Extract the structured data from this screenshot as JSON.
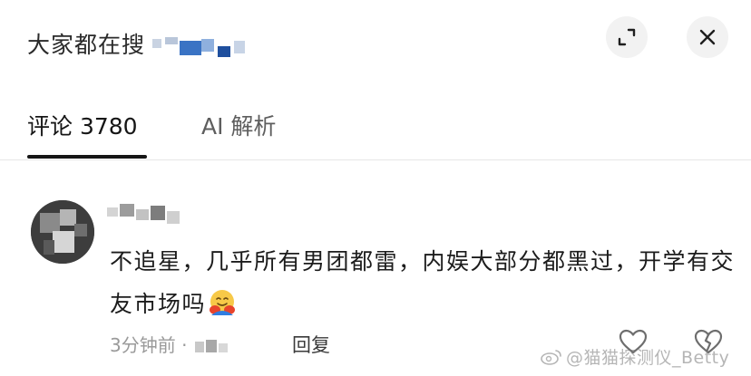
{
  "header": {
    "search_label": "大家都在搜",
    "expand_icon": "expand-icon",
    "close_icon": "close-icon"
  },
  "tabs": [
    {
      "label": "评论 3780",
      "active": true
    },
    {
      "label": "AI 解析",
      "active": false
    }
  ],
  "comment": {
    "text": "不追星，几乎所有男团都雷，内娱大部分都黑过，开学有交友市场吗",
    "emoji": "hugging-face-icon",
    "time": "3分钟前",
    "separator": "·",
    "reply_label": "回复"
  },
  "watermark": {
    "text": "@猫猫探测仪_Betty"
  }
}
